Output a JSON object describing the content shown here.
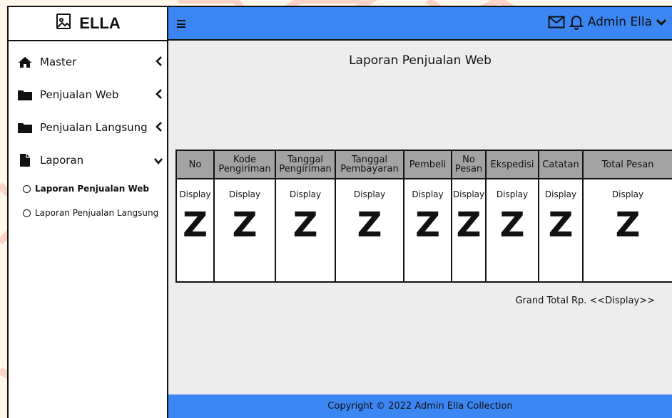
{
  "brand": {
    "name": "ELLA",
    "icon": "image-icon"
  },
  "sidebar": {
    "items": [
      {
        "label": "Master",
        "icon": "home-icon",
        "chevron": "‹"
      },
      {
        "label": "Penjualan Web",
        "icon": "folder-icon",
        "chevron": "‹"
      },
      {
        "label": "Penjualan Langsung",
        "icon": "folder-icon",
        "chevron": "‹"
      },
      {
        "label": "Laporan",
        "icon": "file-icon",
        "chevron": "⌄"
      }
    ],
    "subitems": [
      {
        "label": "Laporan Penjualan Web",
        "active": true
      },
      {
        "label": "Laporan Penjualan Langsung",
        "active": false
      }
    ]
  },
  "topbar": {
    "user": "Admin Ella",
    "colors": {
      "bar": "#3b86f2"
    }
  },
  "main": {
    "title": "Laporan Penjualan Web",
    "table": {
      "headers": [
        "No",
        "Kode Pengiriman",
        "Tanggal Pengiriman",
        "Tanggal Pembayaran",
        "Pembeli",
        "No Pesan",
        "Ekspedisi",
        "Catatan",
        "Total Pesan"
      ],
      "placeholder_text": "Display",
      "placeholder_glyph": "Z"
    },
    "grand_total": "Grand Total Rp. <<Display>>"
  },
  "footer": {
    "text": "Copyright © 2022 Admin Ella Collection"
  }
}
